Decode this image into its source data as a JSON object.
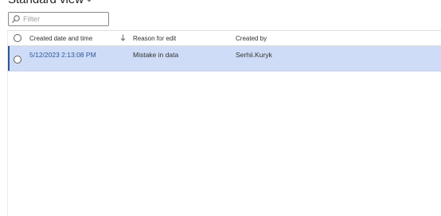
{
  "header": {
    "view_title": "Standard view"
  },
  "filter": {
    "placeholder": "Filter",
    "value": ""
  },
  "grid": {
    "columns": [
      {
        "label": "Created date and time",
        "sorted": "descending"
      },
      {
        "label": "Reason for edit"
      },
      {
        "label": "Created by"
      }
    ],
    "rows": [
      {
        "selected": true,
        "created_date_time": "5/12/2023 2:13:08 PM",
        "reason": "Mistake in data",
        "created_by": "Serhii.Kuryk"
      }
    ]
  },
  "colors": {
    "selected_row": "#cfdcf7",
    "accent": "#2b579a"
  }
}
